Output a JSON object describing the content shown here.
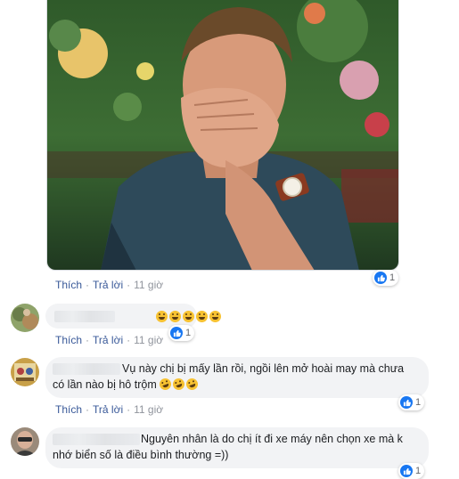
{
  "post_media": {
    "alt": ""
  },
  "post_reactions": {
    "count": "1"
  },
  "post_actions": {
    "like": "Thích",
    "reply": "Trả lời",
    "time": "11 giờ"
  },
  "comments": [
    {
      "text": "",
      "emoji_count": 5,
      "actions": {
        "like": "Thích",
        "reply": "Trả lời",
        "time": "11 giờ"
      },
      "reactions": "1"
    },
    {
      "text_line1": "Vụ này chị bị mấy lần rồi, ngồi lên mở hoài may mà chưa",
      "text_line2": "có lần nào bị hô trộm",
      "actions": {
        "like": "Thích",
        "reply": "Trả lời",
        "time": "11 giờ"
      },
      "reactions": "1"
    },
    {
      "text_line1": "Nguyên nhân là do chị ít đi xe máy nên chọn xe mà k",
      "text_line2": "nhớ biển số là điều bình thường =))",
      "reactions": "1"
    }
  ],
  "colors": {
    "link": "#385898",
    "muted": "#90949c",
    "bubble": "#f2f3f5",
    "like_blue": "#1877f2"
  }
}
